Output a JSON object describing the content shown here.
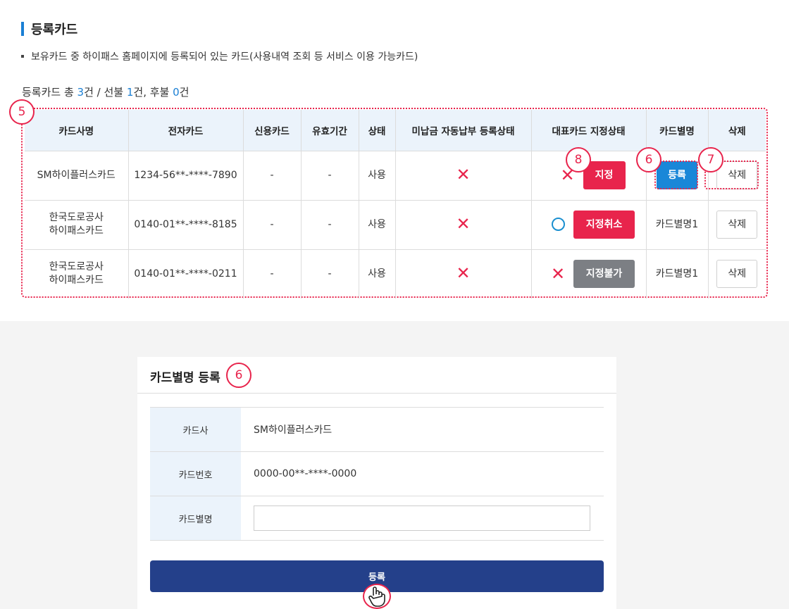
{
  "section": {
    "title": "등록카드",
    "bullet": "보유카드 중 하이패스 홈페이지에 등록되어 있는 카드(사용내역 조회 등 서비스 이용 가능카드)"
  },
  "summary": {
    "prefix": "등록카드 총 ",
    "total": "3",
    "mid1": "건 / 선불 ",
    "prepaid": "1",
    "mid2": "건, 후불 ",
    "postpaid": "0",
    "suffix": "건"
  },
  "table": {
    "headers": [
      "카드사명",
      "전자카드",
      "신용카드",
      "유효기간",
      "상태",
      "미납금 자동납부 등록상태",
      "대표카드 지정상태",
      "카드별명",
      "삭제"
    ],
    "rows": [
      {
        "company": "SM하이플러스카드",
        "ecard": "1234-56**-****-7890",
        "credit": "-",
        "expiry": "-",
        "status": "사용",
        "auto_pay": "✕",
        "rep_mark": "✕",
        "rep_button": "지정",
        "alias": "",
        "alias_button": "등록",
        "delete": "삭제"
      },
      {
        "company": "한국도로공사\n하이패스카드",
        "ecard": "0140-01**-****-8185",
        "credit": "-",
        "expiry": "-",
        "status": "사용",
        "auto_pay": "✕",
        "rep_mark": "○",
        "rep_button": "지정취소",
        "alias": "카드별명1",
        "alias_button": "",
        "delete": "삭제"
      },
      {
        "company": "한국도로공사\n하이패스카드",
        "ecard": "0140-01**-****-0211",
        "credit": "-",
        "expiry": "-",
        "status": "사용",
        "auto_pay": "✕",
        "rep_mark": "✕",
        "rep_button": "지정불가",
        "alias": "카드별명1",
        "alias_button": "",
        "delete": "삭제"
      }
    ]
  },
  "annotations": {
    "table": "5",
    "designate": "8",
    "register": "6",
    "delete": "7",
    "modal": "6"
  },
  "modal": {
    "title": "카드별명 등록",
    "company_label": "카드사",
    "company_value": "SM하이플러스카드",
    "number_label": "카드번호",
    "number_value": "0000-00**-****-0000",
    "alias_label": "카드별명",
    "alias_value": "",
    "submit_label": "등록"
  },
  "colors": {
    "accent_blue": "#1a7fd4",
    "red": "#e8244c",
    "navy": "#24408a",
    "gray_button": "#7c7f84",
    "header_bg": "#ebf3fb"
  }
}
